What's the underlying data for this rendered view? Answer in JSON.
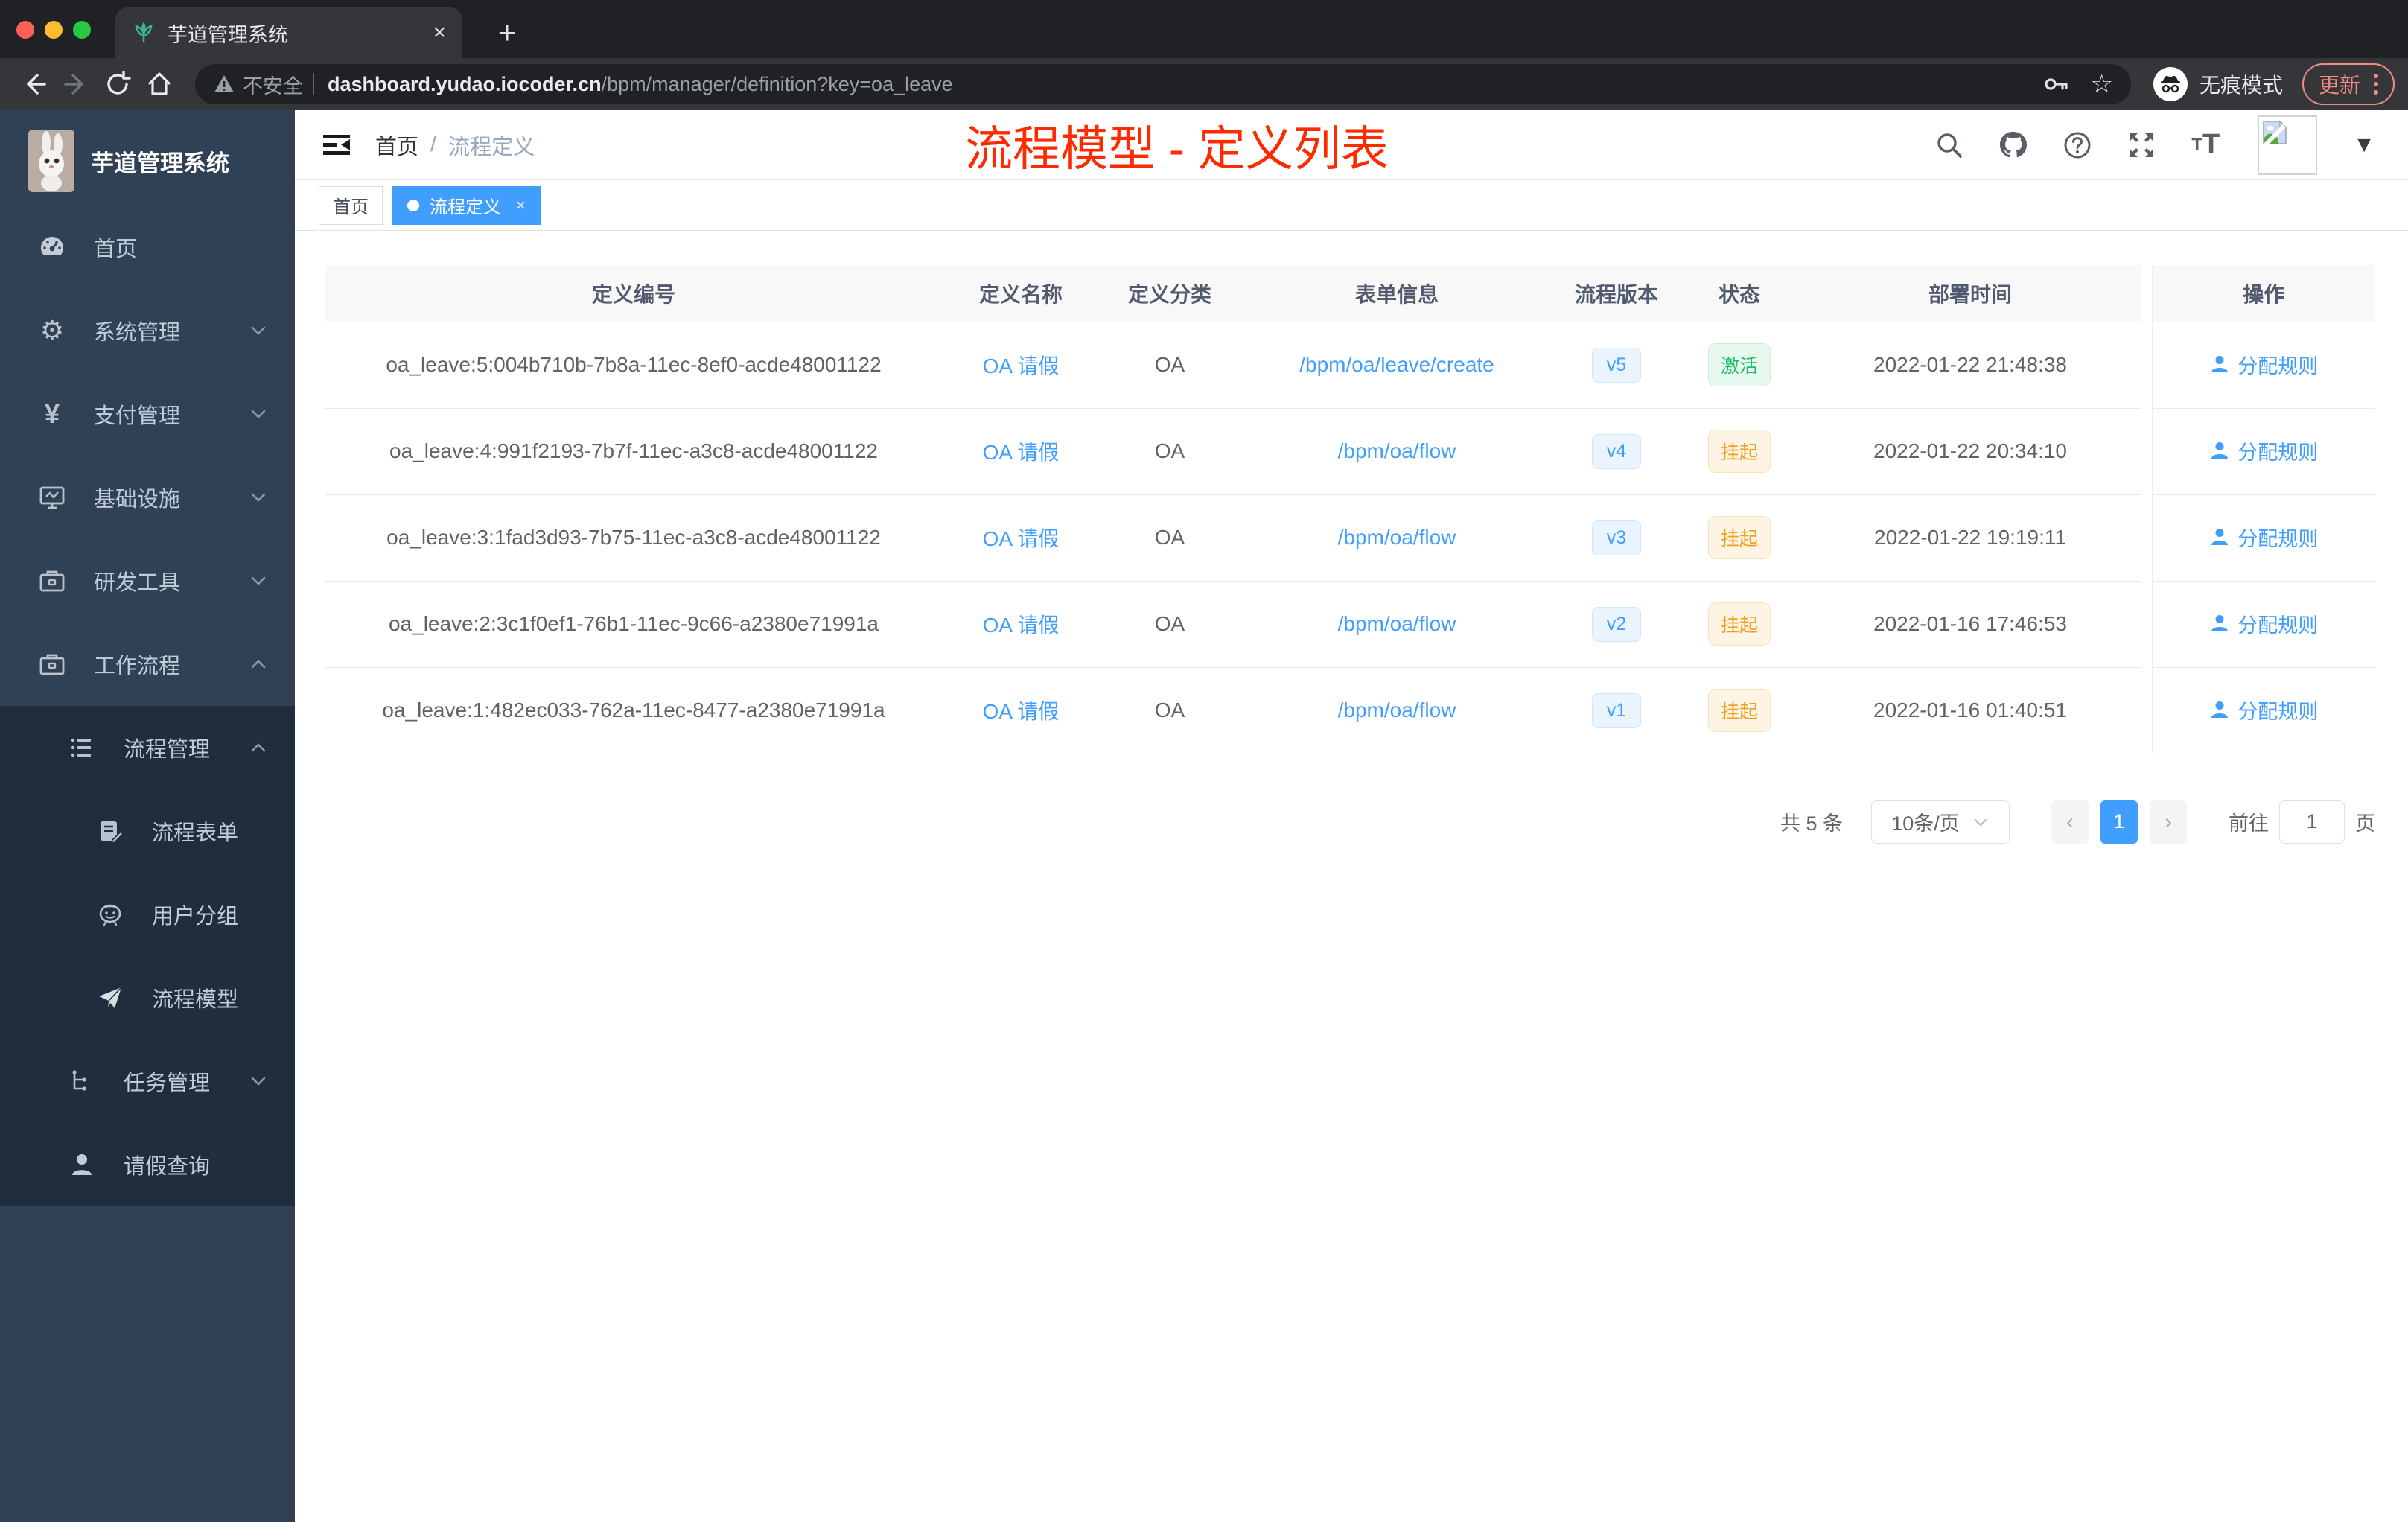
{
  "browser": {
    "tab_title": "芋道管理系统",
    "address": {
      "security_label": "不安全",
      "host": "dashboard.yudao.iocoder.cn",
      "path": "/bpm/manager/definition?key=oa_leave"
    },
    "incognito_label": "无痕模式",
    "update_label": "更新"
  },
  "icons": {
    "close": "×",
    "new_tab": "+",
    "star": "☆",
    "gear": "⚙",
    "yen": "¥",
    "caret_down": "▼",
    "prev": "‹",
    "next": "›"
  },
  "sidebar": {
    "brand": "芋道管理系统",
    "items": {
      "home": "首页",
      "system": "系统管理",
      "payment": "支付管理",
      "infra": "基础设施",
      "devtools": "研发工具",
      "workflow": "工作流程",
      "process_mgmt": "流程管理",
      "process_form": "流程表单",
      "user_group": "用户分组",
      "process_model": "流程模型",
      "task_mgmt": "任务管理",
      "leave_query": "请假查询"
    }
  },
  "navbar": {
    "breadcrumb": {
      "home": "首页",
      "sep": "/",
      "current": "流程定义"
    },
    "annotation": "流程模型 - 定义列表"
  },
  "tags": {
    "home": "首页",
    "active": "流程定义"
  },
  "table": {
    "headers": [
      "定义编号",
      "定义名称",
      "定义分类",
      "表单信息",
      "流程版本",
      "状态",
      "部署时间",
      "操作"
    ],
    "rows": [
      {
        "id": "oa_leave:5:004b710b-7b8a-11ec-8ef0-acde48001122",
        "name": "OA 请假",
        "category": "OA",
        "form": "/bpm/oa/leave/create",
        "version": "v5",
        "status": "激活",
        "status_type": "success",
        "time": "2022-01-22 21:48:38",
        "action": "分配规则"
      },
      {
        "id": "oa_leave:4:991f2193-7b7f-11ec-a3c8-acde48001122",
        "name": "OA 请假",
        "category": "OA",
        "form": "/bpm/oa/flow",
        "version": "v4",
        "status": "挂起",
        "status_type": "warning",
        "time": "2022-01-22 20:34:10",
        "action": "分配规则"
      },
      {
        "id": "oa_leave:3:1fad3d93-7b75-11ec-a3c8-acde48001122",
        "name": "OA 请假",
        "category": "OA",
        "form": "/bpm/oa/flow",
        "version": "v3",
        "status": "挂起",
        "status_type": "warning",
        "time": "2022-01-22 19:19:11",
        "action": "分配规则"
      },
      {
        "id": "oa_leave:2:3c1f0ef1-76b1-11ec-9c66-a2380e71991a",
        "name": "OA 请假",
        "category": "OA",
        "form": "/bpm/oa/flow",
        "version": "v2",
        "status": "挂起",
        "status_type": "warning",
        "time": "2022-01-16 17:46:53",
        "action": "分配规则"
      },
      {
        "id": "oa_leave:1:482ec033-762a-11ec-8477-a2380e71991a",
        "name": "OA 请假",
        "category": "OA",
        "form": "/bpm/oa/flow",
        "version": "v1",
        "status": "挂起",
        "status_type": "warning",
        "time": "2022-01-16 01:40:51",
        "action": "分配规则"
      }
    ]
  },
  "pagination": {
    "total": "共 5 条",
    "page_size": "10条/页",
    "page": "1",
    "goto_prefix": "前往",
    "goto_value": "1",
    "goto_suffix": "页"
  },
  "colors": {
    "accent": "#409eff",
    "annotation_red": "#ff2b00",
    "sidebar_bg": "#304156",
    "sidebar_submenu_bg": "#1f2d3d",
    "status_active": "#19be6b",
    "status_suspended": "#f0a020",
    "incognito_update": "#f28b82"
  }
}
